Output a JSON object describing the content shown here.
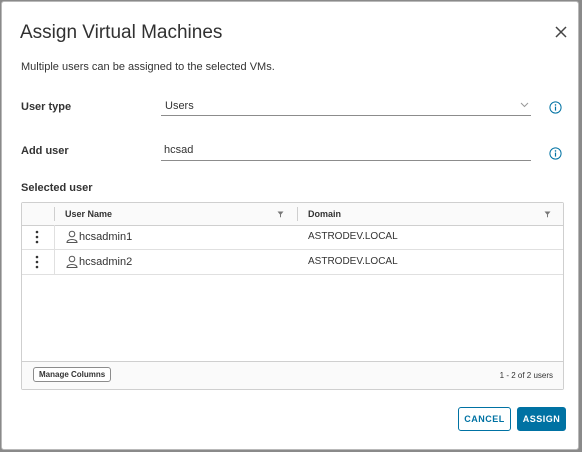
{
  "dialog": {
    "title": "Assign Virtual Machines",
    "subtitle": "Multiple users can be assigned to the selected VMs."
  },
  "form": {
    "user_type_label": "User type",
    "user_type_value": "Users",
    "add_user_label": "Add user",
    "add_user_value": "hcsad",
    "selected_user_label": "Selected user"
  },
  "grid": {
    "columns": [
      "User Name",
      "Domain"
    ],
    "rows": [
      {
        "user_name": "hcsadmin1",
        "domain": "ASTRODEV.LOCAL"
      },
      {
        "user_name": "hcsadmin2",
        "domain": "ASTRODEV.LOCAL"
      }
    ],
    "manage_columns_label": "Manage Columns",
    "pagination": "1 - 2 of 2 users"
  },
  "buttons": {
    "cancel": "CANCEL",
    "assign": "ASSIGN"
  },
  "colors": {
    "accent": "#0072a3",
    "info_icon": "#0072a3"
  },
  "icons": {
    "close": "close-icon",
    "info": "info-icon",
    "filter": "filter-icon",
    "user": "user-icon",
    "row_actions": "kebab-icon",
    "dropdown": "chevron-down-icon"
  }
}
